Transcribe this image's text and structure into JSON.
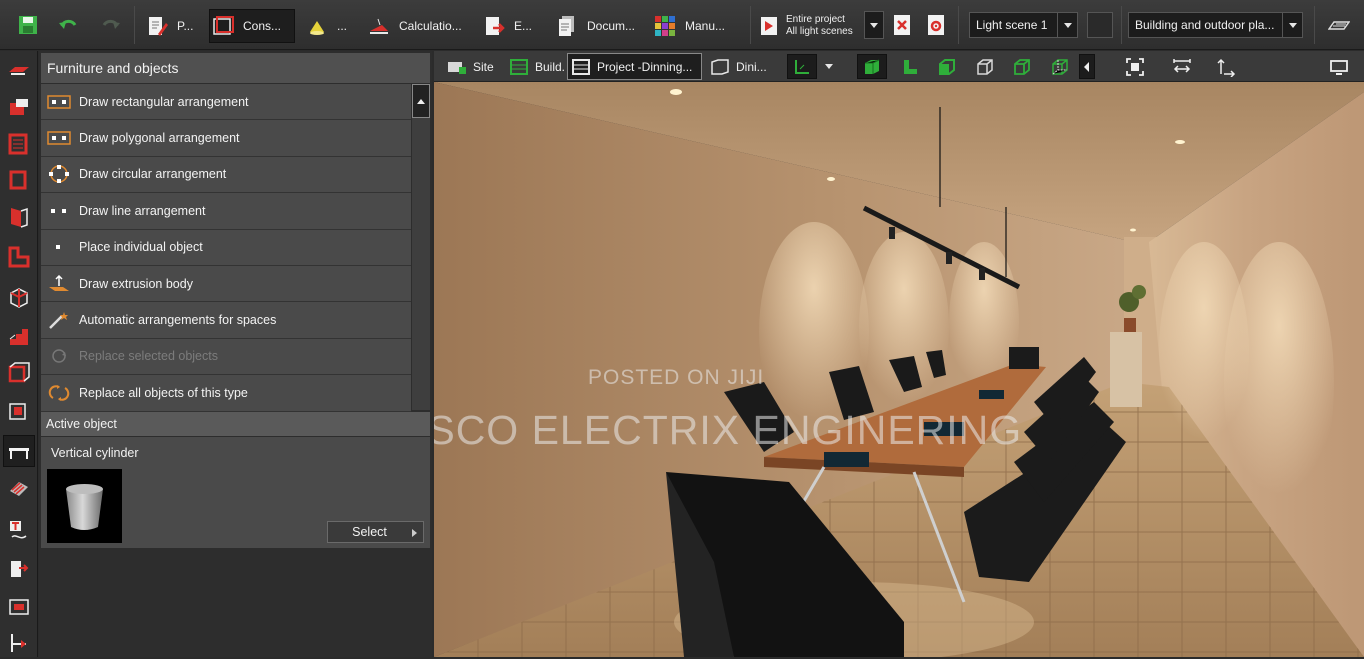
{
  "toolbar": {
    "buttons": [
      {
        "label": "P...",
        "icon": "document-pen-icon"
      },
      {
        "label": "Cons...",
        "icon": "construction-icon"
      },
      {
        "label": "...",
        "icon": "lamp-icon"
      },
      {
        "label": "Calculatio...",
        "icon": "calculation-icon"
      },
      {
        "label": "E...",
        "icon": "export-icon"
      },
      {
        "label": "Docum...",
        "icon": "documentation-icon"
      },
      {
        "label": "Manu...",
        "icon": "manufacturer-icon"
      }
    ],
    "scope_line1": "Entire project",
    "scope_line2": "All light scenes",
    "light_scene": "Light scene 1",
    "view_mode": "Building and outdoor pla..."
  },
  "panel": {
    "title": "Furniture and objects",
    "items": [
      {
        "label": "Draw rectangular arrangement",
        "enabled": true
      },
      {
        "label": "Draw polygonal arrangement",
        "enabled": true
      },
      {
        "label": "Draw circular arrangement",
        "enabled": true
      },
      {
        "label": "Draw line arrangement",
        "enabled": true
      },
      {
        "label": "Place individual object",
        "enabled": true
      },
      {
        "label": "Draw extrusion body",
        "enabled": true
      },
      {
        "label": "Automatic arrangements for spaces",
        "enabled": true
      },
      {
        "label": "Replace selected objects",
        "enabled": false
      },
      {
        "label": "Replace all objects of this type",
        "enabled": true
      }
    ],
    "active_title": "Active object",
    "active_name": "Vertical cylinder",
    "select_label": "Select"
  },
  "view_tabs": [
    {
      "label": "Site"
    },
    {
      "label": "Build..."
    },
    {
      "label": "Project -Dinning..."
    },
    {
      "label": "Dini..."
    }
  ],
  "watermarks": {
    "small": "POSTED ON JIJI",
    "large": "SCISCO ELECTRIX ENGINERING"
  },
  "colors": {
    "accent_green": "#2fae3a",
    "toolbar_red": "#d9302c",
    "wall": "#b08a66"
  }
}
